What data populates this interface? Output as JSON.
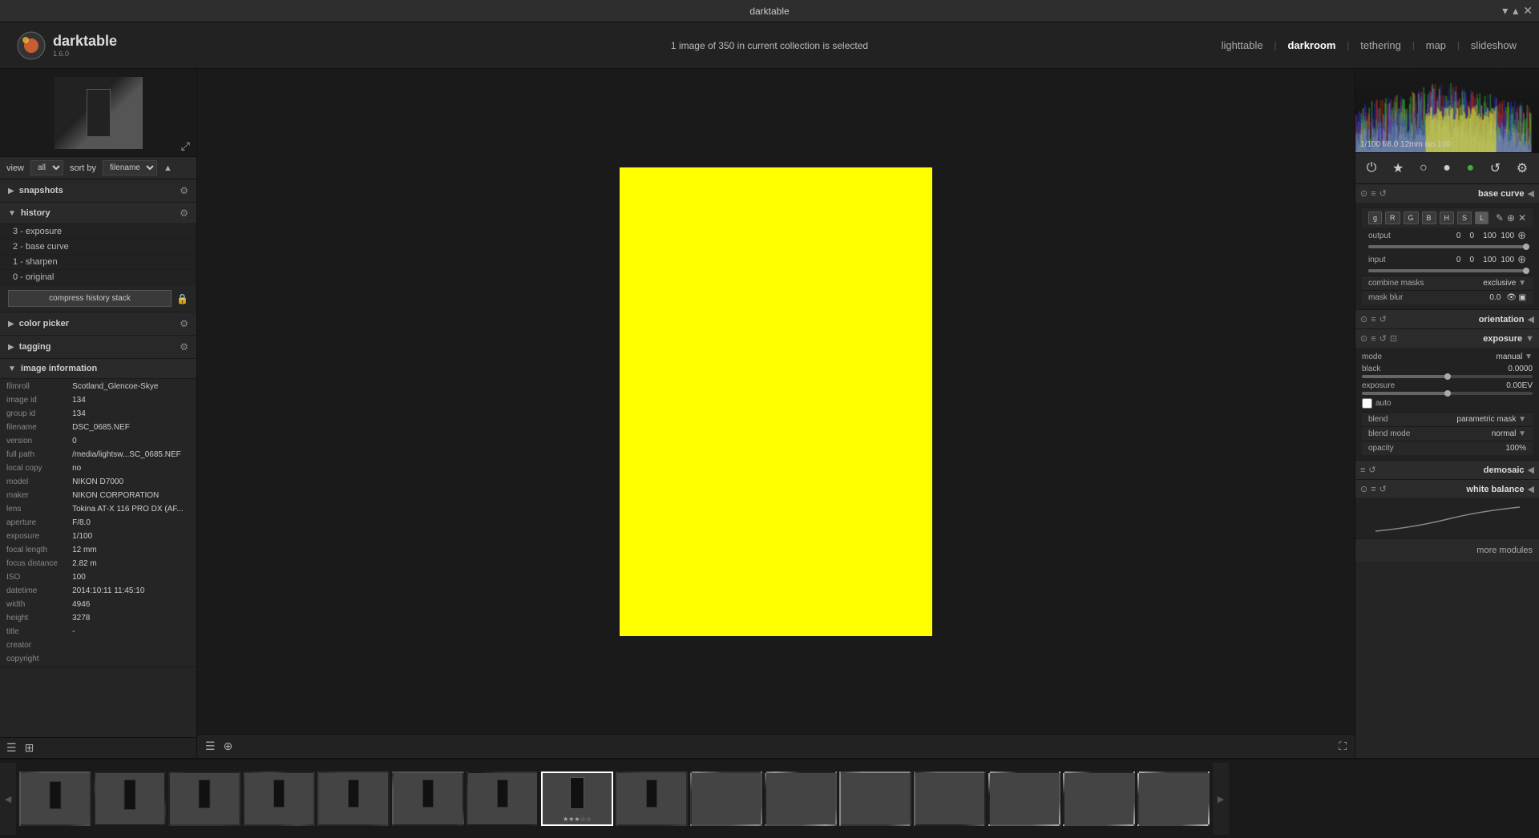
{
  "titlebar": {
    "title": "darktable",
    "controls": [
      "▾",
      "▴",
      "✕"
    ]
  },
  "navbar": {
    "logo_text": "darktable",
    "logo_version": "1.6.0",
    "center_info": "1 image of 350 in current collection is selected",
    "links": [
      "lighttable",
      "darkroom",
      "tethering",
      "map",
      "slideshow"
    ],
    "active_link": "darkroom"
  },
  "left_toolbar": {
    "view_label": "view",
    "view_value": "all",
    "sort_label": "sort by",
    "sort_value": "filename"
  },
  "snapshots": {
    "label": "snapshots",
    "expanded": false
  },
  "history": {
    "label": "history",
    "expanded": true,
    "items": [
      "3 - exposure",
      "2 - base curve",
      "1 - sharpen",
      "0 - original"
    ],
    "compress_btn": "compress history stack"
  },
  "color_picker": {
    "label": "color picker",
    "expanded": false
  },
  "tagging": {
    "label": "tagging",
    "expanded": false
  },
  "image_information": {
    "label": "image information",
    "expanded": true,
    "fields": [
      {
        "key": "filmroll",
        "val": "Scotland_Glencoe-Skye"
      },
      {
        "key": "image id",
        "val": "134"
      },
      {
        "key": "group id",
        "val": "134"
      },
      {
        "key": "filename",
        "val": "DSC_0685.NEF"
      },
      {
        "key": "version",
        "val": "0"
      },
      {
        "key": "full path",
        "val": "/media/lightsw...SC_0685.NEF"
      },
      {
        "key": "local copy",
        "val": "no"
      },
      {
        "key": "model",
        "val": "NIKON D7000"
      },
      {
        "key": "maker",
        "val": "NIKON CORPORATION"
      },
      {
        "key": "lens",
        "val": "Tokina AT-X 116 PRO DX (AF..."
      },
      {
        "key": "aperture",
        "val": "F/8.0"
      },
      {
        "key": "exposure",
        "val": "1/100"
      },
      {
        "key": "focal length",
        "val": "12 mm"
      },
      {
        "key": "focus distance",
        "val": "2.82 m"
      },
      {
        "key": "ISO",
        "val": "100"
      },
      {
        "key": "datetime",
        "val": "2014:10:11 11:45:10"
      },
      {
        "key": "width",
        "val": "4946"
      },
      {
        "key": "height",
        "val": "3278"
      },
      {
        "key": "title",
        "val": "-"
      },
      {
        "key": "creator",
        "val": ""
      },
      {
        "key": "copyright",
        "val": ""
      }
    ]
  },
  "histogram_info": "1/100  f/8.0  12mm  iso 100",
  "right_icon_bar": {
    "icons": [
      "⏻",
      "★",
      "○",
      "●",
      "🟢",
      "↺",
      "⚙"
    ]
  },
  "modules": {
    "base_curve": {
      "name": "base curve",
      "expanded": true,
      "tone_buttons": [
        "g",
        "R",
        "G",
        "B",
        "H",
        "S",
        "L"
      ],
      "active_tone": "L",
      "output_label": "output",
      "output_vals": "0    0    100  100",
      "input_label": "input",
      "input_vals": "0    0    100  100",
      "combine_masks_label": "combine masks",
      "combine_masks_val": "exclusive",
      "mask_blur_label": "mask blur",
      "mask_blur_val": "0.0"
    },
    "orientation": {
      "name": "orientation",
      "expanded": false
    },
    "exposure": {
      "name": "exposure",
      "expanded": true,
      "mode_label": "mode",
      "mode_val": "manual",
      "black_label": "black",
      "black_val": "0.0000",
      "exposure_label": "exposure",
      "exposure_val": "0.00EV",
      "auto_label": "auto",
      "blend_label": "blend",
      "blend_val": "parametric mask",
      "blend_mode_label": "blend mode",
      "blend_mode_val": "normal",
      "opacity_label": "opacity",
      "opacity_val": "100%"
    },
    "demosaic": {
      "name": "demosaic",
      "expanded": false
    },
    "white_balance": {
      "name": "white balance",
      "expanded": false
    }
  },
  "more_modules_btn": "more modules",
  "filmstrip": {
    "images": [
      {
        "id": "f1",
        "cls": "ft1",
        "selected": false
      },
      {
        "id": "f2",
        "cls": "ft2",
        "selected": false
      },
      {
        "id": "f3",
        "cls": "ft3",
        "selected": false
      },
      {
        "id": "f4",
        "cls": "ft4",
        "selected": false
      },
      {
        "id": "f5",
        "cls": "ft5",
        "selected": false
      },
      {
        "id": "f6",
        "cls": "ft6",
        "selected": false
      },
      {
        "id": "f7",
        "cls": "ft7",
        "selected": false
      },
      {
        "id": "f8",
        "cls": "ft-selected",
        "selected": true
      },
      {
        "id": "f9",
        "cls": "ft8",
        "selected": false
      },
      {
        "id": "f10",
        "cls": "ft9",
        "selected": false
      },
      {
        "id": "f11",
        "cls": "ft10",
        "selected": false
      },
      {
        "id": "f12",
        "cls": "ft11",
        "selected": false
      },
      {
        "id": "f13",
        "cls": "ft12",
        "selected": false
      },
      {
        "id": "f14",
        "cls": "ft13",
        "selected": false
      },
      {
        "id": "f15",
        "cls": "ft14",
        "selected": false
      },
      {
        "id": "f16",
        "cls": "ft15",
        "selected": false
      }
    ],
    "stars": "★★★☆☆"
  }
}
